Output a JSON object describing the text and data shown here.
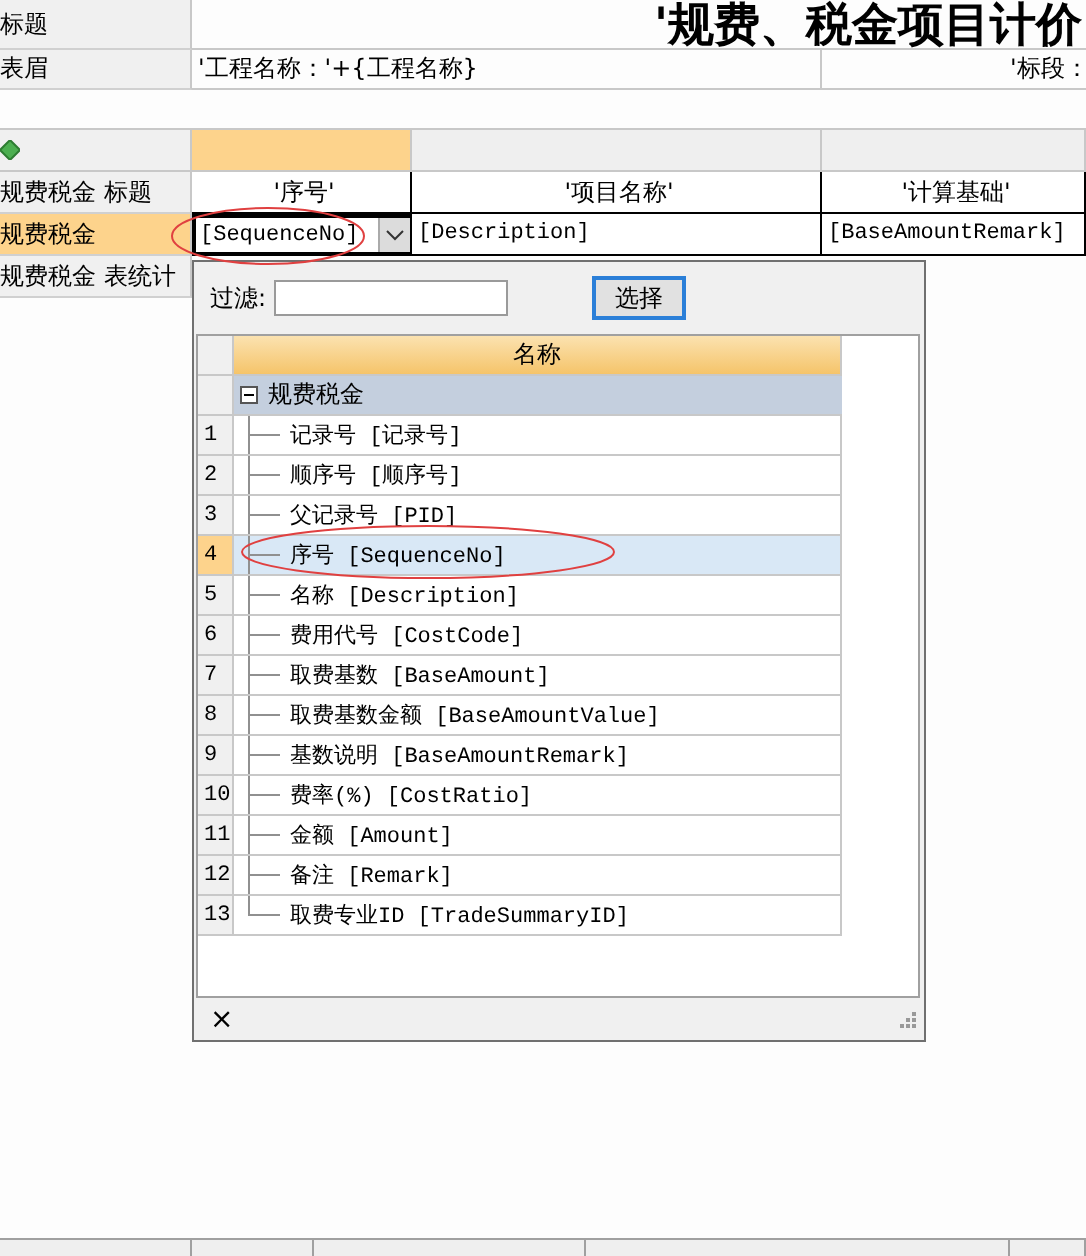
{
  "title_band": {
    "label": "标题",
    "text": "'规费、税金项目计价"
  },
  "header_band": {
    "label": "表眉",
    "cells": [
      "'工程名称：'+{工程名称}",
      "'标段："
    ]
  },
  "column_bar": [
    {
      "selected": true
    },
    {
      "selected": false
    },
    {
      "selected": false
    }
  ],
  "bands": [
    {
      "label": "规费税金 标题",
      "selected": false,
      "cells": [
        {
          "kind": "caption",
          "text": "'序号'"
        },
        {
          "kind": "caption",
          "text": "'项目名称'"
        },
        {
          "kind": "caption",
          "text": "'计算基础'"
        }
      ]
    },
    {
      "label": "规费税金",
      "selected": true,
      "cells": [
        {
          "kind": "dropdown",
          "text": "[SequenceNo]"
        },
        {
          "kind": "field",
          "text": "[Description]"
        },
        {
          "kind": "field",
          "text": "[BaseAmountRemark]"
        }
      ]
    },
    {
      "label": "规费税金 表统计",
      "selected": false
    }
  ],
  "popup": {
    "filter_label": "过滤:",
    "button": "选择",
    "column": "名称",
    "group": {
      "label": "规费税金",
      "expanded": true
    },
    "items": [
      {
        "number": "1",
        "label": "记录号 [记录号]",
        "selected": false
      },
      {
        "number": "2",
        "label": "顺序号 [顺序号]",
        "selected": false
      },
      {
        "number": "3",
        "label": "父记录号 [PID]",
        "selected": false
      },
      {
        "number": "4",
        "label": "序号 [SequenceNo]",
        "selected": true
      },
      {
        "number": "5",
        "label": "名称 [Description]",
        "selected": false
      },
      {
        "number": "6",
        "label": "费用代号 [CostCode]",
        "selected": false
      },
      {
        "number": "7",
        "label": "取费基数 [BaseAmount]",
        "selected": false
      },
      {
        "number": "8",
        "label": "取费基数金额 [BaseAmountValue]",
        "selected": false
      },
      {
        "number": "9",
        "label": "基数说明 [BaseAmountRemark]",
        "selected": false
      },
      {
        "number": "10",
        "label": "费率(%) [CostRatio]",
        "selected": false
      },
      {
        "number": "11",
        "label": "金额 [Amount]",
        "selected": false
      },
      {
        "number": "12",
        "label": "备注 [Remark]",
        "selected": false
      },
      {
        "number": "13",
        "label": "取费专业ID [TradeSummaryID]",
        "selected": false
      }
    ],
    "close": "×"
  }
}
